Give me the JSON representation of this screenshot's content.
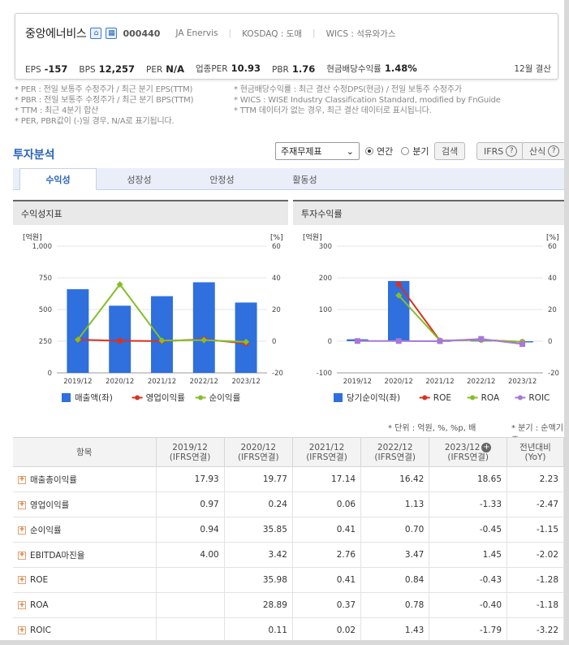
{
  "company": {
    "name": "중앙에너비스",
    "code": "000440",
    "english": "JA Enervis",
    "market": "KOSDAQ : 도매",
    "wics": "WICS : 석유와가스",
    "settlement": "12월 결산"
  },
  "metrics": [
    {
      "label": "EPS",
      "value": "-157"
    },
    {
      "label": "BPS",
      "value": "12,257"
    },
    {
      "label": "PER",
      "value": "N/A"
    },
    {
      "label": "업종PER",
      "value": "10.93"
    },
    {
      "label": "PBR",
      "value": "1.76"
    },
    {
      "label": "현금배당수익률",
      "value": "1.48%"
    }
  ],
  "notes_left": [
    "* PER : 전일 보통주 수정주가 / 최근 분기 EPS(TTM)",
    "* PBR : 전일 보통주 수정주가 / 최근 분기 BPS(TTM)",
    "* TTM : 최근 4분기 합산",
    "* PER, PBR값이 (-)일 경우, N/A로 표기됩니다."
  ],
  "notes_right": [
    "* 현금배당수익률 : 최근 결산 수정DPS(현금) / 전일 보통주 수정주가",
    "* WICS : WISE Industry Classification Standard, modified by FnGuide",
    "* TTM 데이터가 없는 경우, 최근 결산 데이터로 표시됩니다."
  ],
  "section_title": "투자분석",
  "controls": {
    "select": "주재무제표",
    "radio_annual": "연간",
    "radio_quarter": "분기",
    "search": "검색",
    "ifrs": "IFRS",
    "formula": "산식"
  },
  "tabs": [
    "수익성",
    "성장성",
    "안정성",
    "활동성"
  ],
  "chart_data": [
    {
      "type": "bar+line",
      "title": "수익성지표",
      "categories": [
        "2019/12",
        "2020/12",
        "2021/12",
        "2022/12",
        "2023/12"
      ],
      "left_axis": {
        "label": "[억원]",
        "ylim": [
          0,
          1000
        ],
        "ticks": [
          "1,000",
          "750",
          "500",
          "250",
          "0"
        ]
      },
      "right_axis": {
        "label": "[%]",
        "ylim": [
          -20,
          60
        ],
        "ticks": [
          "60",
          "40",
          "20",
          "0",
          "-20"
        ]
      },
      "series": [
        {
          "name": "매출액(좌)",
          "kind": "bar",
          "axis": "left",
          "color": "#2f6fde",
          "values": [
            660,
            530,
            605,
            715,
            555
          ]
        },
        {
          "name": "영업이익률",
          "kind": "line",
          "axis": "right",
          "color": "#d8331f",
          "values": [
            0.97,
            0.24,
            0.06,
            1.13,
            -1.33
          ]
        },
        {
          "name": "순이익률",
          "kind": "line",
          "axis": "right",
          "color": "#86be2a",
          "values": [
            0.94,
            35.85,
            0.41,
            0.7,
            -0.45
          ]
        }
      ]
    },
    {
      "type": "bar+line",
      "title": "투자수익률",
      "categories": [
        "2019/12",
        "2020/12",
        "2021/12",
        "2022/12",
        "2023/12"
      ],
      "left_axis": {
        "label": "[억원]",
        "ylim": [
          -100,
          300
        ],
        "ticks": [
          "300",
          "200",
          "100",
          "0",
          "-100"
        ]
      },
      "right_axis": {
        "label": "[%]",
        "ylim": [
          -20,
          60
        ],
        "ticks": [
          "60",
          "40",
          "20",
          "0",
          "-20"
        ]
      },
      "series": [
        {
          "name": "당기순이익(좌)",
          "kind": "bar",
          "axis": "left",
          "color": "#2f6fde",
          "values": [
            6,
            190,
            2,
            3,
            -2
          ]
        },
        {
          "name": "ROE",
          "kind": "line",
          "axis": "right",
          "color": "#d8331f",
          "values": [
            null,
            35.98,
            0.41,
            0.84,
            -0.43
          ]
        },
        {
          "name": "ROA",
          "kind": "line",
          "axis": "right",
          "color": "#86be2a",
          "values": [
            null,
            28.89,
            0.37,
            0.78,
            -0.4
          ]
        },
        {
          "name": "ROIC",
          "kind": "line",
          "axis": "right",
          "color": "#a678d8",
          "values": [
            0.11,
            0.11,
            0.02,
            1.43,
            -1.79
          ]
        }
      ]
    }
  ],
  "unit_note": "* 단위 : 억원, %, %p, 배",
  "quarter_note": "* 분기 : 순액기준",
  "table": {
    "header_label": "항목",
    "columns": [
      [
        "2019/12",
        "(IFRS연결)"
      ],
      [
        "2020/12",
        "(IFRS연결)"
      ],
      [
        "2021/12",
        "(IFRS연결)"
      ],
      [
        "2022/12",
        "(IFRS연결)"
      ],
      [
        "2023/12",
        "(IFRS연결)"
      ],
      [
        "전년대비",
        "(YoY)"
      ]
    ],
    "rows": [
      {
        "label": "매출총이익률",
        "values": [
          "17.93",
          "19.77",
          "17.14",
          "16.42",
          "18.65",
          "2.23"
        ]
      },
      {
        "label": "영업이익률",
        "values": [
          "0.97",
          "0.24",
          "0.06",
          "1.13",
          "-1.33",
          "-2.47"
        ]
      },
      {
        "label": "순이익률",
        "values": [
          "0.94",
          "35.85",
          "0.41",
          "0.70",
          "-0.45",
          "-1.15"
        ]
      },
      {
        "label": "EBITDA마진율",
        "values": [
          "4.00",
          "3.42",
          "2.76",
          "3.47",
          "1.45",
          "-2.02"
        ]
      },
      {
        "label": "ROE",
        "values": [
          "",
          "35.98",
          "0.41",
          "0.84",
          "-0.43",
          "-1.28"
        ]
      },
      {
        "label": "ROA",
        "values": [
          "",
          "28.89",
          "0.37",
          "0.78",
          "-0.40",
          "-1.18"
        ]
      },
      {
        "label": "ROIC",
        "values": [
          "",
          "0.11",
          "0.02",
          "1.43",
          "-1.79",
          "-3.22"
        ]
      }
    ]
  }
}
